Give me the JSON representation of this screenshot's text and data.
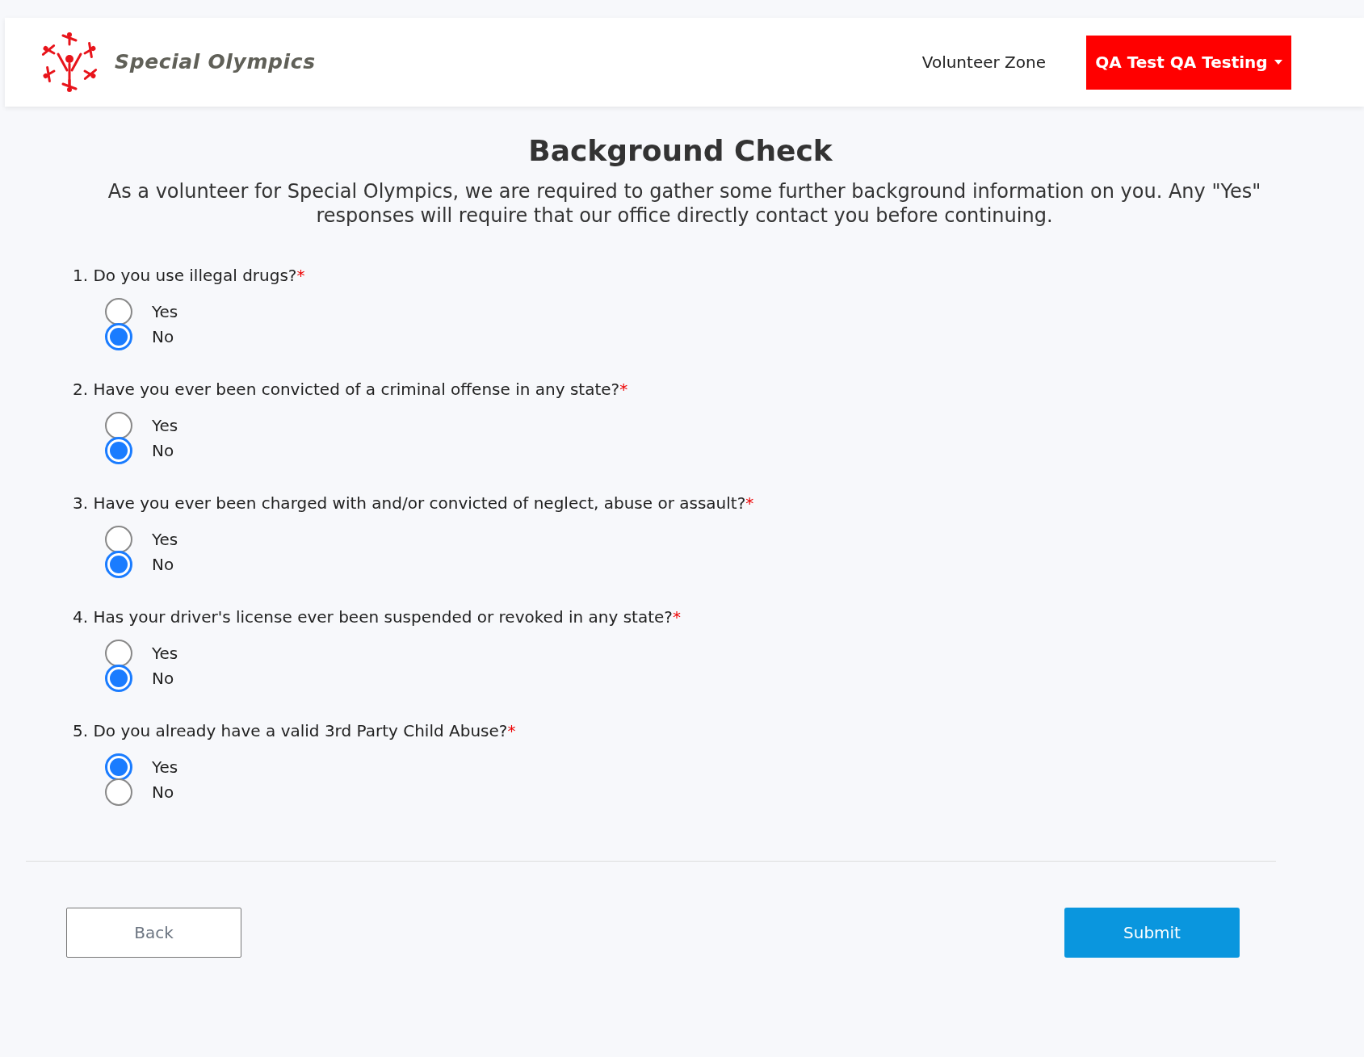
{
  "header": {
    "logo_text": "Special Olympics",
    "nav_link": "Volunteer Zone",
    "user_menu": "QA Test QA Testing"
  },
  "page": {
    "title": "Background Check",
    "intro": "As a volunteer for Special Olympics, we are required to gather some further background information on you. Any \"Yes\" responses will require that our office directly contact you before continuing."
  },
  "questions": [
    {
      "text": "1. Do you use illegal drugs?",
      "required_mark": "*",
      "options": [
        {
          "label": "Yes",
          "selected": false
        },
        {
          "label": "No",
          "selected": true
        }
      ]
    },
    {
      "text": "2. Have you ever been convicted of a criminal offense in any state?",
      "required_mark": "*",
      "options": [
        {
          "label": "Yes",
          "selected": false
        },
        {
          "label": "No",
          "selected": true
        }
      ]
    },
    {
      "text": "3. Have you ever been charged with and/or convicted of neglect, abuse or assault?",
      "required_mark": "*",
      "options": [
        {
          "label": "Yes",
          "selected": false
        },
        {
          "label": "No",
          "selected": true
        }
      ]
    },
    {
      "text": "4. Has your driver's license ever been suspended or revoked in any state?",
      "required_mark": "*",
      "options": [
        {
          "label": "Yes",
          "selected": false
        },
        {
          "label": "No",
          "selected": true
        }
      ]
    },
    {
      "text": "5. Do you already have a valid 3rd Party Child Abuse?",
      "required_mark": "*",
      "options": [
        {
          "label": "Yes",
          "selected": true
        },
        {
          "label": "No",
          "selected": false
        }
      ]
    }
  ],
  "buttons": {
    "back": "Back",
    "submit": "Submit"
  }
}
